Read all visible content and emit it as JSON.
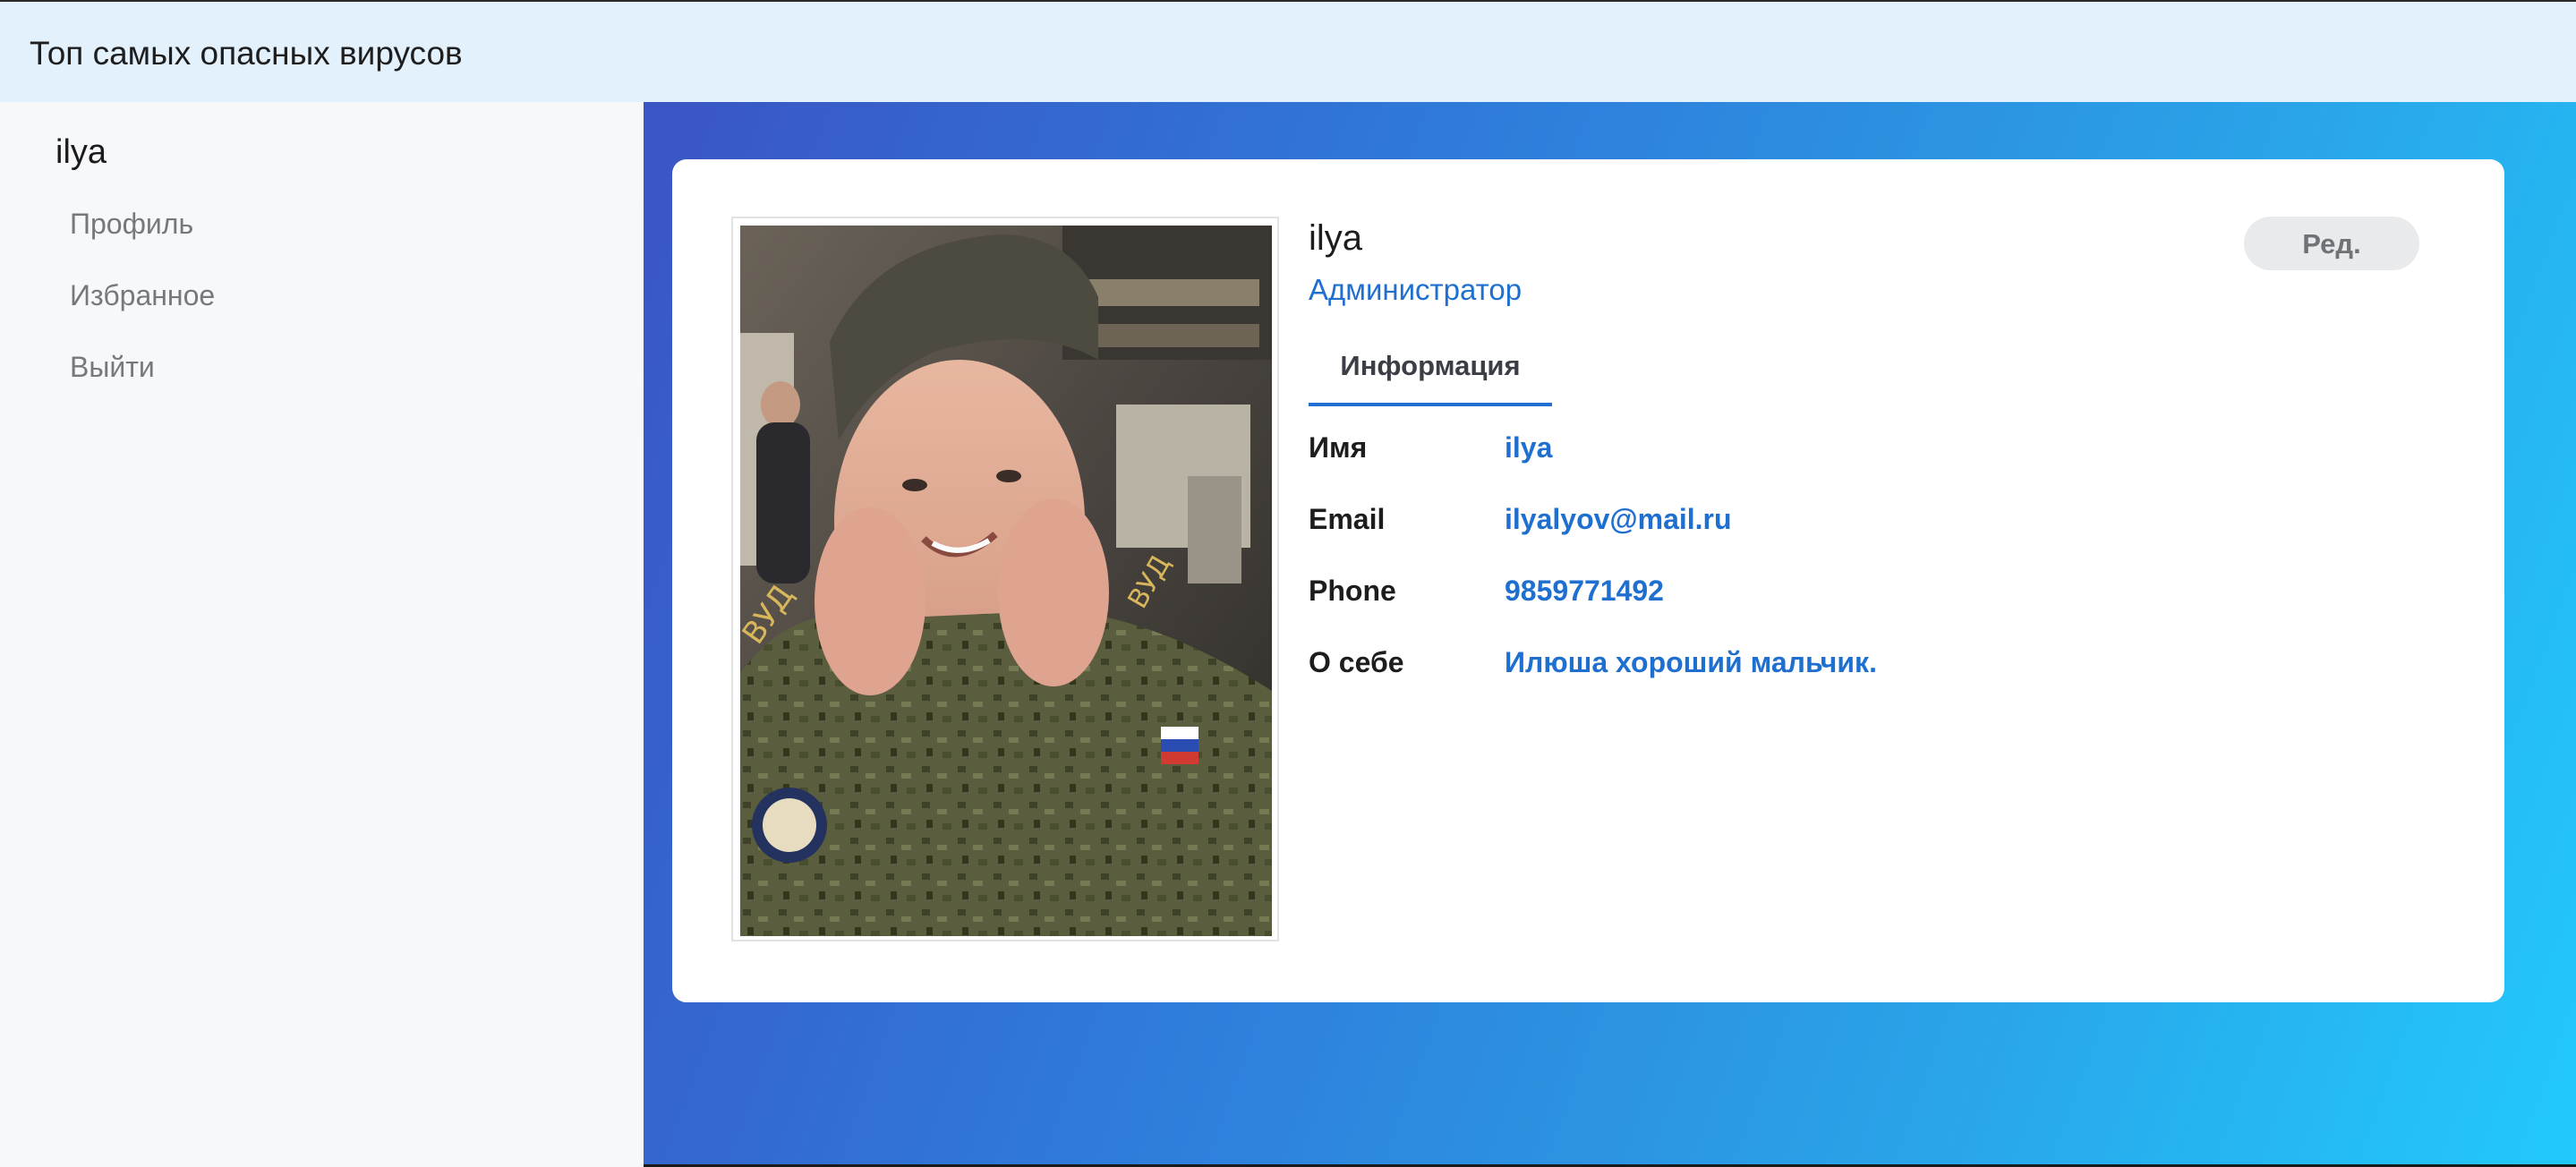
{
  "header": {
    "title": "Топ самых опасных вирусов"
  },
  "sidebar": {
    "username": "ilya",
    "items": [
      {
        "label": "Профиль"
      },
      {
        "label": "Избранное"
      },
      {
        "label": "Выйти"
      }
    ]
  },
  "profile": {
    "name": "ilya",
    "role": "Администратор",
    "edit_label": "Ред.",
    "photo_icon": "user-photo",
    "tabs": [
      {
        "label": "Информация"
      }
    ],
    "fields": [
      {
        "label": "Имя",
        "value": "ilya"
      },
      {
        "label": "Email",
        "value": "ilyalyov@mail.ru"
      },
      {
        "label": "Phone",
        "value": "9859771492"
      },
      {
        "label": "О себе",
        "value": "Илюша хороший мальчик."
      }
    ]
  },
  "colors": {
    "accent": "#1e6fcf",
    "topbar": "#e3f1fd",
    "sidebar": "#f7f8fa",
    "gradient_start": "#3a55c4",
    "gradient_end": "#22c9fb"
  }
}
